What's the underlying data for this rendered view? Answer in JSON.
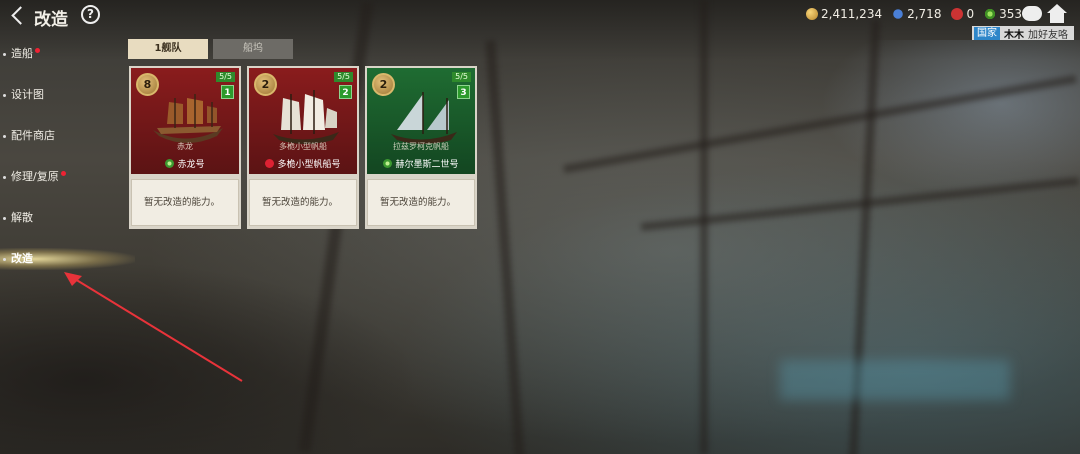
{
  "header": {
    "title": "改造",
    "help_label": "?"
  },
  "resources": [
    {
      "icon": "coin-icon",
      "value": "2,411,234"
    },
    {
      "icon": "gem-icon",
      "value": "2,718"
    },
    {
      "icon": "ticket-icon",
      "value": "0"
    },
    {
      "icon": "ship-wheel-icon",
      "value": "353"
    }
  ],
  "nation": {
    "tag": "国家",
    "name": "木木",
    "action": "加好友咯"
  },
  "menu": [
    {
      "label": "造船",
      "badge": true
    },
    {
      "label": "设计图",
      "badge": false
    },
    {
      "label": "配件商店",
      "badge": false
    },
    {
      "label": "修理/复原",
      "badge": true
    },
    {
      "label": "解散",
      "badge": false
    },
    {
      "label": "改造",
      "badge": false,
      "active": true
    }
  ],
  "tabs": [
    {
      "label": "1舰队",
      "selected": true
    },
    {
      "label": "船坞",
      "selected": false
    }
  ],
  "cards": [
    {
      "tier": "8",
      "slots": "5/5",
      "rank": "1",
      "caption": "赤龙",
      "name": "赤龙号",
      "theme": "red",
      "nation_icon": "green",
      "ability": "暂无改造的能力。"
    },
    {
      "tier": "2",
      "slots": "5/5",
      "rank": "2",
      "caption": "多桅小型帆船",
      "name": "多桅小型帆船号",
      "theme": "red",
      "nation_icon": "red",
      "ability": "暂无改造的能力。"
    },
    {
      "tier": "2",
      "slots": "5/5",
      "rank": "3",
      "caption": "拉兹罗柯克帆船",
      "name": "赫尔墨斯二世号",
      "theme": "green",
      "nation_icon": "green",
      "ability": "暂无改造的能力。"
    }
  ],
  "colors": {
    "card_red": "#8a1c1d",
    "card_green": "#1f6c32",
    "tab_active": "#e8dcc0",
    "badge": "#e22233",
    "annotation_arrow": "#e8333a"
  }
}
